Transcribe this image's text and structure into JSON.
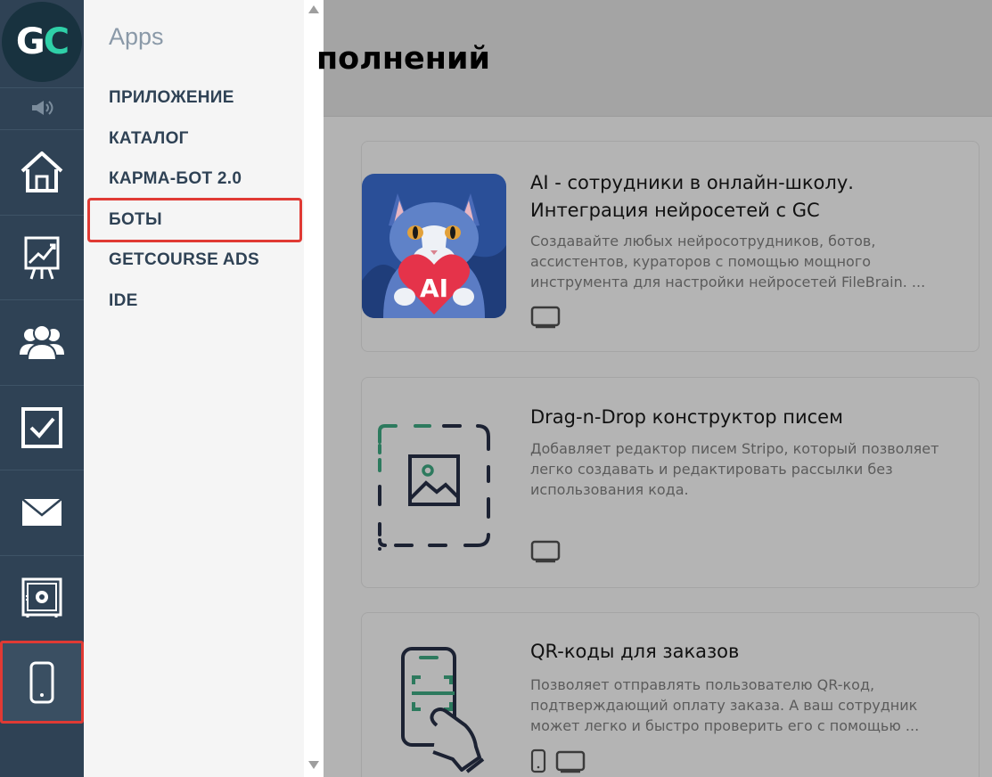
{
  "logo": {
    "text_g": "G",
    "text_c": "C"
  },
  "sidebar": {
    "items": [
      {
        "name": "home",
        "icon": "home-icon"
      },
      {
        "name": "analytics",
        "icon": "chart-board-icon"
      },
      {
        "name": "users",
        "icon": "users-icon"
      },
      {
        "name": "tasks",
        "icon": "checkbox-icon"
      },
      {
        "name": "mail",
        "icon": "envelope-icon"
      },
      {
        "name": "settings",
        "icon": "safe-gear-icon"
      },
      {
        "name": "apps",
        "icon": "mobile-icon",
        "active": true
      }
    ]
  },
  "panel": {
    "title": "Apps",
    "items": [
      {
        "label": "ПРИЛОЖЕНИЕ"
      },
      {
        "label": "КАТАЛОГ"
      },
      {
        "label": "КАРМА-БОТ 2.0"
      },
      {
        "label": "БОТЫ",
        "highlighted": true
      },
      {
        "label": "GETCOURSE ADS"
      },
      {
        "label": "IDE"
      }
    ]
  },
  "main": {
    "title": "полнений",
    "cards": [
      {
        "title": "AI - сотрудники в онлайн-школу. Интеграция нейросетей с GC",
        "description": "Создавайте любых нейросотрудников, ботов, ассистентов, кураторов с помощью мощного инструмента для настройки нейросетей FileBrain. ...",
        "image_text": "AI",
        "platforms": [
          "desktop"
        ]
      },
      {
        "title": "Drag-n-Drop конструктор писем",
        "description": "Добавляет редактор писем Stripo, который позволяет легко создавать и редактировать рассылки без использования кода.",
        "platforms": [
          "desktop"
        ]
      },
      {
        "title": "QR-коды для заказов",
        "description": "Позволяет отправлять пользователю QR-код, подтверждающий оплату заказа. А ваш сотрудник может легко и быстро проверить его с помощью ...",
        "platforms": [
          "mobile",
          "desktop"
        ]
      }
    ]
  },
  "colors": {
    "sidebar": "#2f4255",
    "accent": "#2fd0a8",
    "highlight": "#e03a34"
  }
}
